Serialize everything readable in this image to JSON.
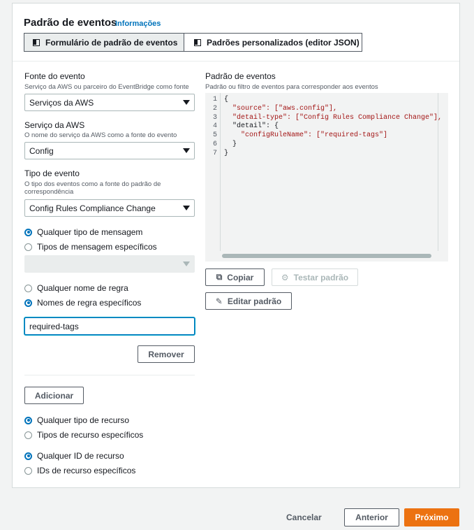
{
  "panel": {
    "title": "Padrão de eventos",
    "info_link": "Informações",
    "tabs": [
      {
        "label": "Formulário de padrão de eventos",
        "active": true
      },
      {
        "label": "Padrões personalizados (editor JSON)",
        "active": false
      }
    ]
  },
  "form": {
    "event_source": {
      "label": "Fonte do evento",
      "description": "Serviço da AWS ou parceiro do EventBridge como fonte",
      "value": "Serviços da AWS"
    },
    "aws_service": {
      "label": "Serviço da AWS",
      "description": "O nome do serviço da AWS como a fonte do evento",
      "value": "Config"
    },
    "event_type": {
      "label": "Tipo de evento",
      "description": "O tipo dos eventos como a fonte do padrão de correspondência",
      "value": "Config Rules Compliance Change"
    },
    "message_type": {
      "options": [
        "Qualquer tipo de mensagem",
        "Tipos de mensagem específicos"
      ],
      "selected": 0,
      "specific_value": ""
    },
    "rule_name": {
      "options": [
        "Qualquer nome de regra",
        "Nomes de regra específicos"
      ],
      "selected": 1,
      "value": "required-tags",
      "remove_label": "Remover",
      "add_label": "Adicionar"
    },
    "resource_type": {
      "options": [
        "Qualquer tipo de recurso",
        "Tipos de recurso específicos"
      ],
      "selected": 0
    },
    "resource_id": {
      "options": [
        "Qualquer ID de recurso",
        "IDs de recurso específicos"
      ],
      "selected": 0
    }
  },
  "pattern": {
    "label": "Padrão de eventos",
    "description": "Padrão ou filtro de eventos para corresponder aos eventos",
    "line_numbers": [
      "1",
      "2",
      "3",
      "4",
      "5",
      "6",
      "7"
    ],
    "code_lines": [
      "{",
      "  \"source\": [\"aws.config\"],",
      "  \"detail-type\": [\"Config Rules Compliance Change\"],",
      "  \"detail\": {",
      "    \"configRuleName\": [\"required-tags\"]",
      "  }",
      "}"
    ],
    "copy_label": "Copiar",
    "test_label": "Testar padrão",
    "edit_label": "Editar padrão"
  },
  "footer": {
    "cancel_label": "Cancelar",
    "previous_label": "Anterior",
    "next_label": "Próximo"
  },
  "colors": {
    "primary": "#ec7211",
    "link": "#0073bb"
  }
}
